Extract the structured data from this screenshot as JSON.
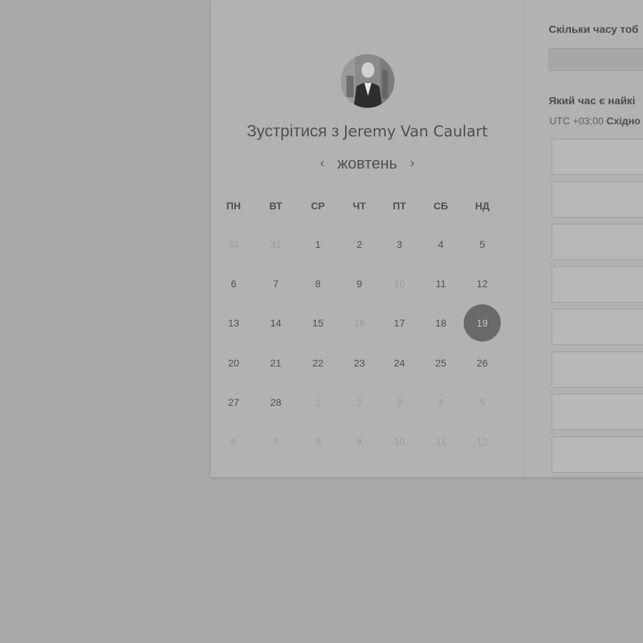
{
  "header": {
    "title_prefix": "Зустрітися з",
    "host_name": "Jeremy Van Caulart"
  },
  "calendar": {
    "month_label": "жовтень",
    "prev_icon": "‹",
    "next_icon": "›",
    "weekdays": [
      "ПН",
      "ВТ",
      "СР",
      "ЧТ",
      "ПТ",
      "СБ",
      "НД"
    ],
    "selected_day": "19",
    "weeks": [
      [
        {
          "d": "30",
          "muted": true
        },
        {
          "d": "31",
          "muted": true
        },
        {
          "d": "1",
          "muted": false
        },
        {
          "d": "2",
          "muted": false
        },
        {
          "d": "3",
          "muted": false
        },
        {
          "d": "4",
          "muted": false
        },
        {
          "d": "5",
          "muted": false
        }
      ],
      [
        {
          "d": "6",
          "muted": false
        },
        {
          "d": "7",
          "muted": false
        },
        {
          "d": "8",
          "muted": false
        },
        {
          "d": "9",
          "muted": false
        },
        {
          "d": "10",
          "muted": true
        },
        {
          "d": "11",
          "muted": false
        },
        {
          "d": "12",
          "muted": false
        }
      ],
      [
        {
          "d": "13",
          "muted": false
        },
        {
          "d": "14",
          "muted": false
        },
        {
          "d": "15",
          "muted": false
        },
        {
          "d": "16",
          "muted": true
        },
        {
          "d": "17",
          "muted": false
        },
        {
          "d": "18",
          "muted": false
        },
        {
          "d": "19",
          "muted": false,
          "selected": true
        }
      ],
      [
        {
          "d": "20",
          "muted": false
        },
        {
          "d": "21",
          "muted": false
        },
        {
          "d": "22",
          "muted": false
        },
        {
          "d": "23",
          "muted": false
        },
        {
          "d": "24",
          "muted": false
        },
        {
          "d": "25",
          "muted": false
        },
        {
          "d": "26",
          "muted": false
        }
      ],
      [
        {
          "d": "27",
          "muted": false
        },
        {
          "d": "28",
          "muted": false
        },
        {
          "d": "1",
          "muted": true
        },
        {
          "d": "2",
          "muted": true
        },
        {
          "d": "3",
          "muted": true
        },
        {
          "d": "4",
          "muted": true
        },
        {
          "d": "5",
          "muted": true
        }
      ],
      [
        {
          "d": "6",
          "muted": true
        },
        {
          "d": "7",
          "muted": true
        },
        {
          "d": "8",
          "muted": true
        },
        {
          "d": "9",
          "muted": true
        },
        {
          "d": "10",
          "muted": true
        },
        {
          "d": "11",
          "muted": true
        },
        {
          "d": "12",
          "muted": true
        }
      ]
    ]
  },
  "booking": {
    "duration_question": "Скільки часу тоб",
    "time_question": "Який час є найкі",
    "timezone_offset": "UTC +03:00",
    "timezone_name": "Східно",
    "visible_slot_count": 8
  },
  "colors": {
    "overlay_background": "#a9a9a9",
    "card_background": "#b2b2b2",
    "selected_day": "#6a6a6a"
  }
}
